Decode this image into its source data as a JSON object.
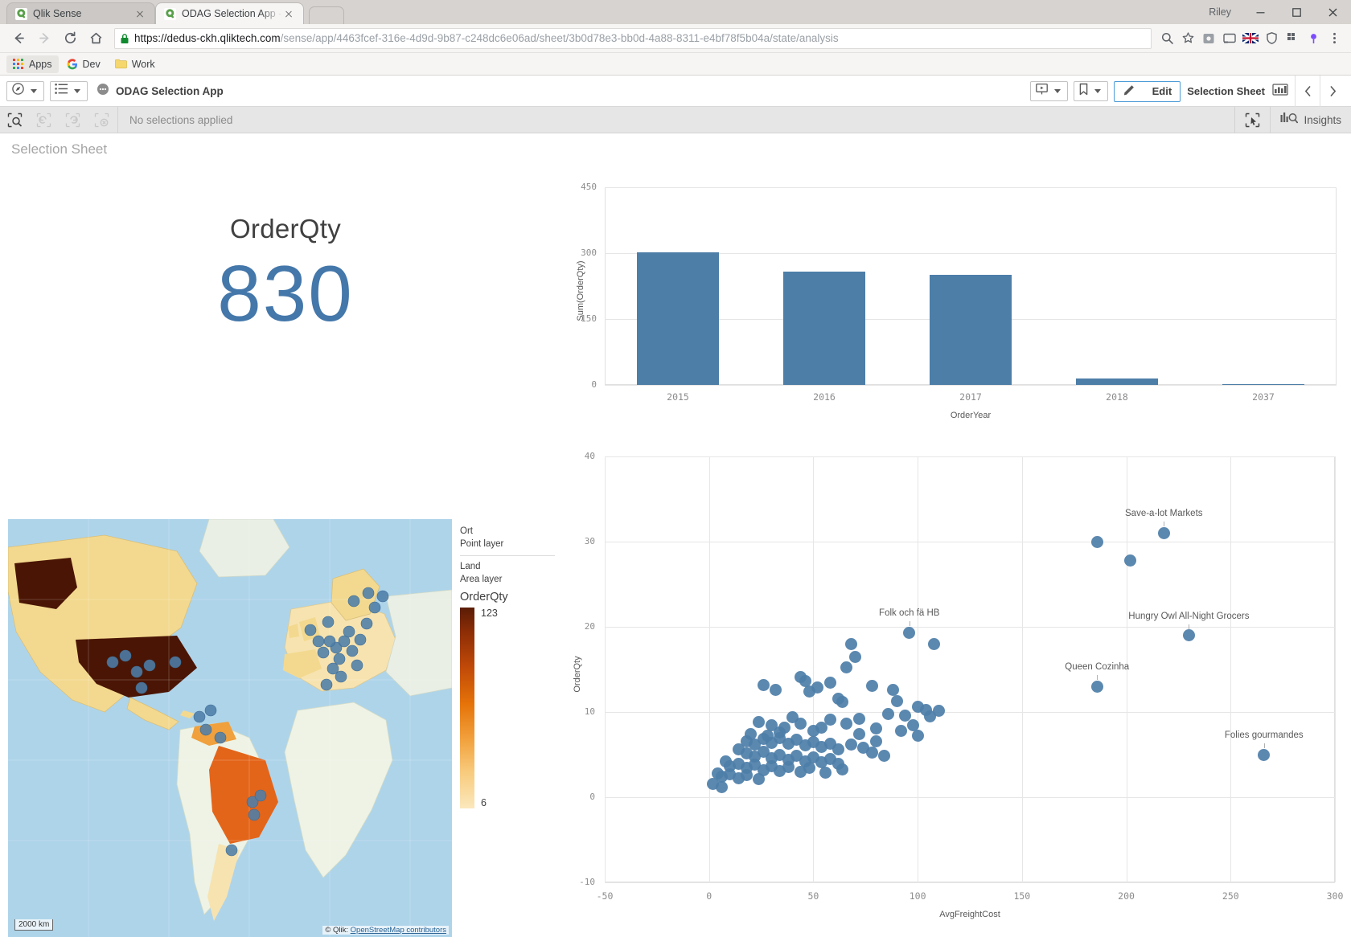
{
  "browser": {
    "tabs": [
      {
        "title": "Qlik Sense",
        "icon": "qlik-favicon",
        "active": false
      },
      {
        "title": "ODAG Selection App - My",
        "icon": "qlik-favicon",
        "active": true
      }
    ],
    "new_tab_label": "+",
    "nav": {
      "back_icon": "back-arrow-icon",
      "forward_icon": "forward-arrow-icon",
      "reload_icon": "reload-icon",
      "home_icon": "home-icon"
    },
    "omnibox": {
      "lock_icon": "lock-icon",
      "scheme": "https://",
      "host": "dedus-ckh.qliktech.com",
      "path": "/sense/app/4463fcef-316e-4d9d-9b87-c248dc6e06ad/sheet/3b0d78e3-bb0d-4a88-8311-e4bf78f5b04a/state/analysis",
      "full_url": "https://dedus-ckh.qliktech.com/sense/app/4463fcef-316e-4d9d-9b87-c248dc6e06ad/sheet/3b0d78e3-bb0d-4a88-8311-e4bf78f5b04a/state/analysis",
      "zoom_icon": "zoom-icon",
      "star_icon": "star-icon"
    },
    "extensions": [
      "puzzle-icon",
      "cast-icon",
      "flag-icon",
      "shield-icon",
      "grid-icon",
      "pin-icon"
    ],
    "bookmarks": [
      {
        "label": "Apps",
        "icon": "apps-grid-icon"
      },
      {
        "label": "Dev",
        "icon": "google-icon"
      },
      {
        "label": "Work",
        "icon": "folder-icon"
      }
    ],
    "window": {
      "user": "Riley",
      "minimize": "minimize-icon",
      "maximize": "maximize-icon",
      "close": "close-icon"
    }
  },
  "qlik_header": {
    "nav_button_icon": "compass-icon",
    "sheets_button_icon": "list-icon",
    "app_icon": "app-icon",
    "app_title": "ODAG Selection App",
    "storytelling_icon": "play-slideshow-icon",
    "bookmark_icon": "bookmark-icon",
    "edit_label": "Edit",
    "edit_icon": "pencil-icon",
    "sheet_name": "Selection Sheet",
    "sheet_icon": "sheet-grid-icon",
    "prev_icon": "chevron-left-icon",
    "next_icon": "chevron-right-icon"
  },
  "selection_bar": {
    "selection_tool_icon": "selection-search-icon",
    "back_icon": "step-back-icon",
    "forward_icon": "step-forward-icon",
    "clear_icon": "clear-selections-icon",
    "status_text": "No selections applied",
    "smart_search_icon": "smart-select-icon",
    "insights_icon": "insights-icon",
    "insights_label": "Insights"
  },
  "sheet": {
    "title": "Selection Sheet"
  },
  "kpi": {
    "label": "OrderQty",
    "value": "830",
    "color": "#4477aa"
  },
  "map": {
    "legend": {
      "layers": [
        {
          "name": "Ort",
          "type": "Point layer"
        },
        {
          "name": "Land",
          "type": "Area layer"
        }
      ],
      "measure_title": "OrderQty",
      "max_value": "123",
      "min_value": "6",
      "gradient_high": "#5a1c06",
      "gradient_low": "#fbe8bd"
    },
    "scale_label": "2000 km",
    "attribution_prefix": "© Qlik: ",
    "attribution_link": "OpenStreetMap contributors"
  },
  "chart_data": [
    {
      "type": "bar",
      "title": "",
      "xlabel": "OrderYear",
      "ylabel": "Sum(OrderQty)",
      "categories": [
        "2015",
        "2016",
        "2017",
        "2018",
        "2037"
      ],
      "values": [
        302,
        258,
        250,
        15,
        2
      ],
      "yticks": [
        0,
        150,
        300,
        450
      ],
      "ylim": [
        0,
        450
      ],
      "grid": true,
      "bar_color": "#4d7ea8"
    },
    {
      "type": "scatter",
      "title": "",
      "xlabel": "AvgFreightCost",
      "ylabel": "OrderQty",
      "xticks": [
        -50,
        0,
        50,
        100,
        150,
        200,
        250,
        300
      ],
      "yticks": [
        -10,
        0,
        10,
        20,
        30,
        40
      ],
      "xlim": [
        -50,
        300
      ],
      "ylim": [
        -10,
        40
      ],
      "grid": true,
      "point_color": "#4d7ea8",
      "annotations": [
        {
          "label": "Save-a-lot Markets",
          "x": 218,
          "y": 31
        },
        {
          "label": "Hungry Owl All-Night Grocers",
          "x": 230,
          "y": 19
        },
        {
          "label": "Folk och fä HB",
          "x": 96,
          "y": 19.3
        },
        {
          "label": "Queen Cozinha",
          "x": 186,
          "y": 13
        },
        {
          "label": "Folies gourmandes",
          "x": 266,
          "y": 5
        }
      ],
      "points": [
        {
          "x": 186,
          "y": 30
        },
        {
          "x": 202,
          "y": 27.8
        },
        {
          "x": 218,
          "y": 31
        },
        {
          "x": 230,
          "y": 19
        },
        {
          "x": 186,
          "y": 13
        },
        {
          "x": 266,
          "y": 5
        },
        {
          "x": 96,
          "y": 19.3
        },
        {
          "x": 108,
          "y": 18
        },
        {
          "x": 68,
          "y": 18
        },
        {
          "x": 70,
          "y": 16.5
        },
        {
          "x": 66,
          "y": 15.2
        },
        {
          "x": 26,
          "y": 13.2
        },
        {
          "x": 32,
          "y": 12.6
        },
        {
          "x": 44,
          "y": 14.1
        },
        {
          "x": 46,
          "y": 13.6
        },
        {
          "x": 48,
          "y": 12.4
        },
        {
          "x": 52,
          "y": 12.9
        },
        {
          "x": 58,
          "y": 13.4
        },
        {
          "x": 62,
          "y": 11.6
        },
        {
          "x": 64,
          "y": 11.2
        },
        {
          "x": 78,
          "y": 13.1
        },
        {
          "x": 88,
          "y": 12.6
        },
        {
          "x": 90,
          "y": 11.3
        },
        {
          "x": 100,
          "y": 10.6
        },
        {
          "x": 104,
          "y": 10.2
        },
        {
          "x": 110,
          "y": 10.1
        },
        {
          "x": 86,
          "y": 9.8
        },
        {
          "x": 94,
          "y": 9.6
        },
        {
          "x": 98,
          "y": 8.4
        },
        {
          "x": 80,
          "y": 8.1
        },
        {
          "x": 72,
          "y": 9.2
        },
        {
          "x": 66,
          "y": 8.6
        },
        {
          "x": 58,
          "y": 9.1
        },
        {
          "x": 54,
          "y": 8.2
        },
        {
          "x": 50,
          "y": 7.8
        },
        {
          "x": 44,
          "y": 8.6
        },
        {
          "x": 40,
          "y": 9.4
        },
        {
          "x": 36,
          "y": 8.2
        },
        {
          "x": 34,
          "y": 7.6
        },
        {
          "x": 30,
          "y": 8.4
        },
        {
          "x": 28,
          "y": 7.2
        },
        {
          "x": 24,
          "y": 8.8
        },
        {
          "x": 20,
          "y": 7.4
        },
        {
          "x": 18,
          "y": 6.6
        },
        {
          "x": 22,
          "y": 6.2
        },
        {
          "x": 26,
          "y": 6.8
        },
        {
          "x": 30,
          "y": 6.4
        },
        {
          "x": 34,
          "y": 6.9
        },
        {
          "x": 38,
          "y": 6.3
        },
        {
          "x": 42,
          "y": 6.7
        },
        {
          "x": 46,
          "y": 6.1
        },
        {
          "x": 50,
          "y": 6.5
        },
        {
          "x": 54,
          "y": 5.9
        },
        {
          "x": 58,
          "y": 6.3
        },
        {
          "x": 62,
          "y": 5.6
        },
        {
          "x": 68,
          "y": 6.2
        },
        {
          "x": 74,
          "y": 5.8
        },
        {
          "x": 78,
          "y": 5.2
        },
        {
          "x": 84,
          "y": 4.9
        },
        {
          "x": 14,
          "y": 5.6
        },
        {
          "x": 18,
          "y": 5.1
        },
        {
          "x": 22,
          "y": 4.8
        },
        {
          "x": 26,
          "y": 5.3
        },
        {
          "x": 30,
          "y": 4.6
        },
        {
          "x": 34,
          "y": 5.0
        },
        {
          "x": 38,
          "y": 4.4
        },
        {
          "x": 42,
          "y": 4.9
        },
        {
          "x": 46,
          "y": 4.2
        },
        {
          "x": 50,
          "y": 4.7
        },
        {
          "x": 54,
          "y": 4.1
        },
        {
          "x": 58,
          "y": 4.5
        },
        {
          "x": 62,
          "y": 3.9
        },
        {
          "x": 8,
          "y": 4.2
        },
        {
          "x": 10,
          "y": 3.6
        },
        {
          "x": 14,
          "y": 3.9
        },
        {
          "x": 18,
          "y": 3.4
        },
        {
          "x": 22,
          "y": 3.8
        },
        {
          "x": 26,
          "y": 3.2
        },
        {
          "x": 30,
          "y": 3.6
        },
        {
          "x": 34,
          "y": 3.1
        },
        {
          "x": 38,
          "y": 3.5
        },
        {
          "x": 44,
          "y": 3.0
        },
        {
          "x": 48,
          "y": 3.4
        },
        {
          "x": 56,
          "y": 2.9
        },
        {
          "x": 64,
          "y": 3.3
        },
        {
          "x": 4,
          "y": 2.8
        },
        {
          "x": 6,
          "y": 2.4
        },
        {
          "x": 10,
          "y": 2.7
        },
        {
          "x": 14,
          "y": 2.2
        },
        {
          "x": 18,
          "y": 2.6
        },
        {
          "x": 24,
          "y": 2.1
        },
        {
          "x": 2,
          "y": 1.6
        },
        {
          "x": 6,
          "y": 1.2
        },
        {
          "x": 72,
          "y": 7.4
        },
        {
          "x": 80,
          "y": 6.6
        },
        {
          "x": 92,
          "y": 7.8
        },
        {
          "x": 100,
          "y": 7.2
        },
        {
          "x": 106,
          "y": 9.5
        }
      ]
    }
  ]
}
